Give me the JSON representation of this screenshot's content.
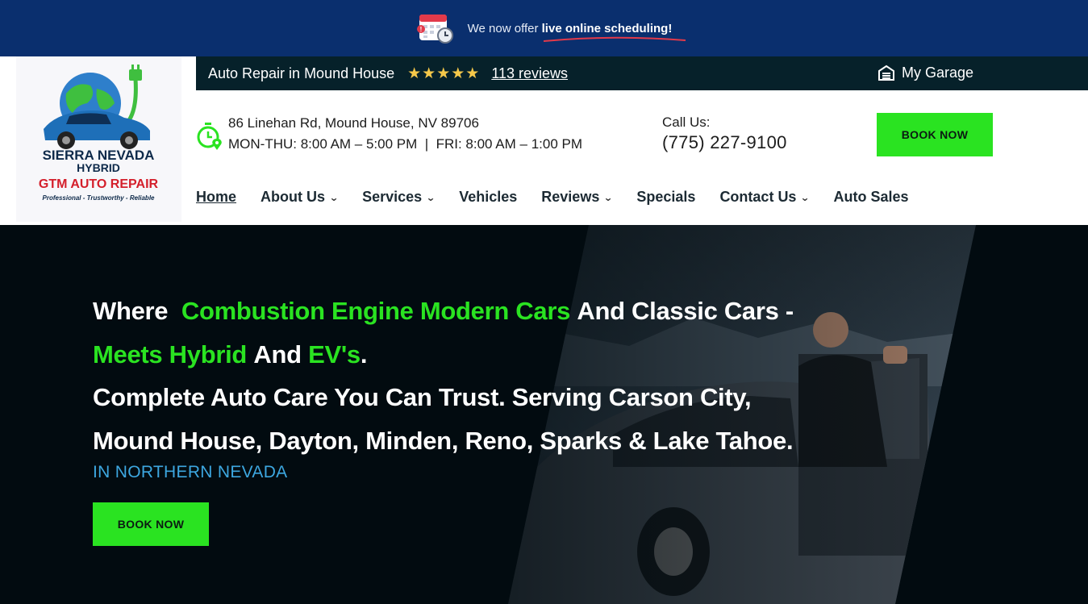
{
  "banner": {
    "prefix": "We now offer",
    "highlight": "live online scheduling!",
    "icon": "calendar-clock-icon"
  },
  "logo": {
    "line1": "SIERRA NEVADA",
    "line2": "HYBRID",
    "line3": "GTM AUTO REPAIR",
    "tagline": "Professional - Trustworthy - Reliable"
  },
  "topbar": {
    "location": "Auto Repair in Mound House",
    "stars": "★★★★★",
    "reviews": "113 reviews",
    "garage": "My Garage"
  },
  "info": {
    "address": "86 Linehan Rd, Mound House, NV 89706",
    "hours": "MON-THU: 8:00 AM – 5:00 PM  |  FRI: 8:00 AM – 1:00 PM"
  },
  "call": {
    "label": "Call Us:",
    "phone": "(775) 227-9100"
  },
  "book_label": "BOOK NOW",
  "nav": {
    "home": "Home",
    "about": "About Us",
    "services": "Services",
    "vehicles": "Vehicles",
    "reviews": "Reviews",
    "specials": "Specials",
    "contact": "Contact Us",
    "sales": "Auto Sales"
  },
  "hero": {
    "l1a": "Where",
    "l1b": "Combustion Engine Modern Cars",
    "l1c": "And Classic Cars -",
    "l2a": "Meets Hybrid",
    "l2b": "And",
    "l2c": "EV's",
    "l2d": ".",
    "l3": "Complete Auto Care You Can Trust. Serving Carson City,",
    "l4": "Mound House, Dayton, Minden, Reno, Sparks & Lake Tahoe.",
    "sub": "IN NORTHERN NEVADA",
    "button": "BOOK NOW"
  },
  "colors": {
    "banner": "#0a2f6e",
    "accent_green": "#2ae321",
    "topbar": "#06212a",
    "sub_blue": "#3da7e0"
  }
}
